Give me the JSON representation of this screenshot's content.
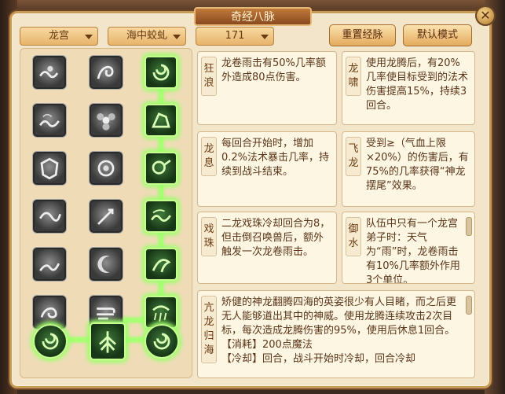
{
  "window": {
    "title": "奇经八脉",
    "close_symbol": "✕"
  },
  "controls": {
    "school": "龙宫",
    "branch": "海中蛟虬",
    "level": "171",
    "reset_label": "重置经脉",
    "default_label": "默认模式"
  },
  "skills": [
    {
      "name": "狂\n浪",
      "desc": "龙卷雨击有50%几率额外造成80点伤害。"
    },
    {
      "name": "龙\n啸",
      "desc": "使用龙腾后，有20%几率使目标受到的法术伤害提高15%，持续3回合。"
    },
    {
      "name": "龙\n息",
      "desc": "每回合开始时，增加0.2%法术暴击几率，持续到战斗结束。"
    },
    {
      "name": "飞\n龙",
      "desc": "受到≥（气血上限×20%）的伤害后，有75%的几率获得“神龙摆尾”效果。"
    },
    {
      "name": "戏\n珠",
      "desc": "二龙戏珠冷却回合为8，但击倒召唤兽后，额外触发一次龙卷雨击。"
    },
    {
      "name": "御\n水",
      "desc": "队伍中只有一个龙宫弟子时：天气为“雨”时，龙卷雨击有10%几率额外作用3个单位。"
    }
  ],
  "ultimate": {
    "name": "亢\n龙\n归\n海",
    "desc": "矫健的神龙翻腾四海的英姿很少有人目睹，而之后更无人能够道出其中的神威。使用龙腾连续攻击2次目标，每次造成龙腾伤害的95%，使用后休息1回合。",
    "cost": "【消耗】200点魔法",
    "extra": "【冷却】回合，战斗开始时冷却，回合冷却"
  },
  "grid_icons": [
    [
      "wave-icon",
      "dragon-icon",
      "swirl-icon"
    ],
    [
      "tide-icon",
      "flower-icon",
      "dragon-head-icon"
    ],
    [
      "shield-icon",
      "orb-icon",
      "dragon-head-icon"
    ],
    [
      "dragon-icon",
      "sword-icon",
      "wave-icon"
    ],
    [
      "tide-icon",
      "moon-icon",
      "dragon-head-icon"
    ],
    [
      "dragon-icon",
      "wind-icon",
      "rain-icon"
    ],
    [
      "swirl-icon",
      "tree-icon",
      "swirl-icon"
    ]
  ]
}
